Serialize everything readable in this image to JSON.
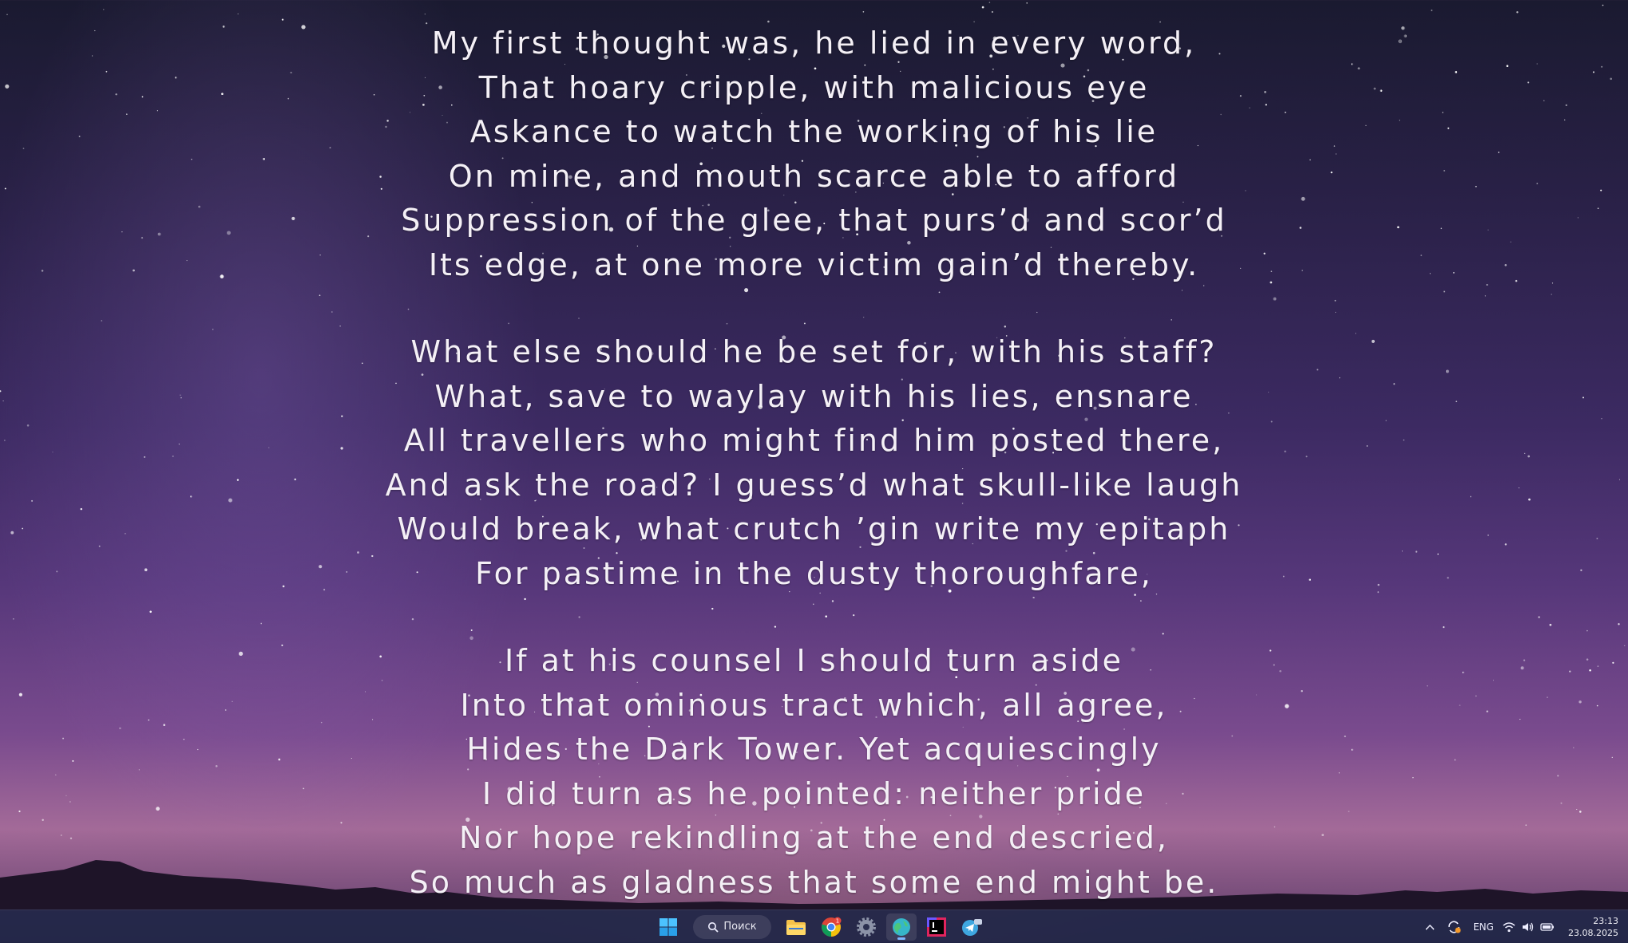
{
  "poem": {
    "stanzas": [
      [
        "My first thought was, he lied in every word,",
        "That hoary cripple, with malicious eye",
        "Askance to watch the working of his lie",
        "On mine, and mouth scarce able to afford",
        "Suppression of the glee, that purs’d and scor’d",
        "Its edge, at one more victim gain’d thereby."
      ],
      [
        "What else should he be set for, with his staff?",
        "What, save to waylay with his lies, ensnare",
        "All travellers who might find him posted there,",
        "And ask the road? I guess’d what skull-like laugh",
        "Would break, what crutch ’gin write my epitaph",
        "For pastime in the dusty thoroughfare,"
      ],
      [
        "If at his counsel I should turn aside",
        "Into that ominous tract which, all agree,",
        "Hides the Dark Tower. Yet acquiescingly",
        "I did turn as he pointed: neither pride",
        "Nor hope rekindling at the end descried,",
        "So much as gladness that some end might be."
      ]
    ]
  },
  "taskbar": {
    "search_label": "Поиск",
    "apps": [
      {
        "name": "start-button",
        "icon": "windows-logo"
      },
      {
        "name": "file-explorer",
        "icon": "folder-icon"
      },
      {
        "name": "chrome",
        "icon": "chrome-icon",
        "badge": "1"
      },
      {
        "name": "settings",
        "icon": "gear-icon"
      },
      {
        "name": "browser",
        "icon": "globe-icon",
        "active": true
      },
      {
        "name": "jetbrains",
        "icon": "ide-icon"
      },
      {
        "name": "telegram",
        "icon": "telegram-icon"
      }
    ],
    "tray": {
      "language": "ENG",
      "time": "23:13",
      "date": "23.08.2025"
    }
  },
  "colors": {
    "text": "#f4f0f6",
    "taskbar": "#202646",
    "accent": "#7db7ff"
  }
}
